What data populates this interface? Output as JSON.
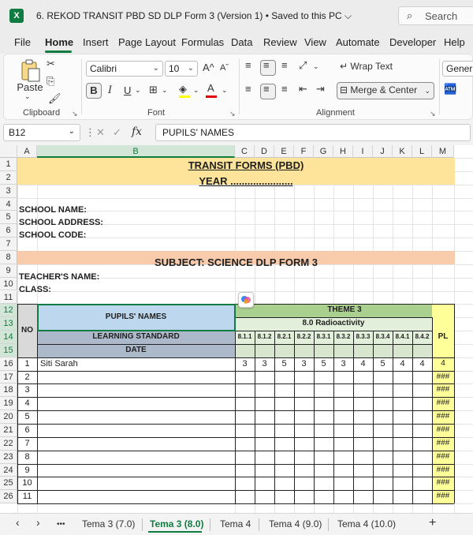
{
  "window": {
    "app_icon": "excel-icon",
    "title": "6. REKOD TRANSIT PBD SD DLP Form 3 (Version 1) • Saved to this PC",
    "search_placeholder": "Search"
  },
  "ribbon_tabs": [
    "File",
    "Home",
    "Insert",
    "Page Layout",
    "Formulas",
    "Data",
    "Review",
    "View",
    "Automate",
    "Developer",
    "Help"
  ],
  "active_tab": "Home",
  "ribbon": {
    "clipboard": {
      "paste_label": "Paste",
      "group_label": "Clipboard"
    },
    "font": {
      "font_name": "Calibri",
      "font_size": "10",
      "bold": "B",
      "italic": "I",
      "underline": "U",
      "grow": "A",
      "shrink": "A",
      "font_color_label": "A",
      "group_label": "Font"
    },
    "alignment": {
      "wrap_text": "Wrap Text",
      "merge_center": "Merge & Center",
      "group_label": "Alignment"
    },
    "number": {
      "format": "General"
    }
  },
  "formula_bar": {
    "cell_ref": "B12",
    "formula": "PUPILS' NAMES",
    "fx": "fx"
  },
  "columns": [
    "A",
    "B",
    "C",
    "D",
    "E",
    "F",
    "G",
    "H",
    "I",
    "J",
    "K",
    "L",
    "M"
  ],
  "rows": [
    "1",
    "2",
    "3",
    "4",
    "5",
    "6",
    "7",
    "8",
    "9",
    "10",
    "11",
    "12",
    "13",
    "14",
    "15",
    "16",
    "17",
    "18",
    "19",
    "20",
    "21",
    "22",
    "23",
    "24",
    "25",
    "26"
  ],
  "sheet": {
    "title": "TRANSIT FORMS (PBD)",
    "year": "YEAR ......................",
    "school_name": "SCHOOL NAME:",
    "school_address": "SCHOOL ADDRESS:",
    "school_code": "SCHOOL CODE:",
    "subject": "SUBJECT: SCIENCE DLP FORM 3",
    "teacher": "TEACHER'S NAME:",
    "class": "CLASS:",
    "no_label": "NO",
    "pupils_names": "PUPILS' NAMES",
    "learning_standard": "LEARNING STANDARD",
    "date": "DATE",
    "theme": "THEME 3",
    "topic": "8.0 Radioactivity",
    "pl": "PL",
    "standards": [
      "8.1.1",
      "8.1.2",
      "8.2.1",
      "8.2.2",
      "8.3.1",
      "8.3.2",
      "8.3.3",
      "8.3.4",
      "8.4.1",
      "8.4.2"
    ],
    "students": [
      {
        "no": "1",
        "name": "Siti Sarah",
        "scores": [
          "3",
          "3",
          "5",
          "3",
          "5",
          "3",
          "4",
          "5",
          "4",
          "4"
        ],
        "pl": "4"
      },
      {
        "no": "2",
        "name": "",
        "scores": [],
        "pl": "###"
      },
      {
        "no": "3",
        "name": "",
        "scores": [],
        "pl": "###"
      },
      {
        "no": "4",
        "name": "",
        "scores": [],
        "pl": "###"
      },
      {
        "no": "5",
        "name": "",
        "scores": [],
        "pl": "###"
      },
      {
        "no": "6",
        "name": "",
        "scores": [],
        "pl": "###"
      },
      {
        "no": "7",
        "name": "",
        "scores": [],
        "pl": "###"
      },
      {
        "no": "8",
        "name": "",
        "scores": [],
        "pl": "###"
      },
      {
        "no": "9",
        "name": "",
        "scores": [],
        "pl": "###"
      },
      {
        "no": "10",
        "name": "",
        "scores": [],
        "pl": "###"
      },
      {
        "no": "11",
        "name": "",
        "scores": [],
        "pl": "###"
      }
    ]
  },
  "sheet_tabs": [
    "Tema 3 (7.0)",
    "Tema 3 (8.0)",
    "Tema 4",
    "Tema 4 (9.0)",
    "Tema 4 (10.0)"
  ],
  "active_sheet": "Tema 3 (8.0)",
  "nav": {
    "prev": "‹",
    "next": "›",
    "more": "•••",
    "add": "+"
  },
  "colors": {
    "accent": "#107c41",
    "yellow_fill": "#fde49a",
    "peach_fill": "#f8cbad",
    "green_fill": "#a9d08e",
    "light_green_fill": "#e2efda",
    "blue_fill": "#bdd7ee",
    "gray_fill": "#acb9ca",
    "pl_fill": "#ffff99"
  }
}
